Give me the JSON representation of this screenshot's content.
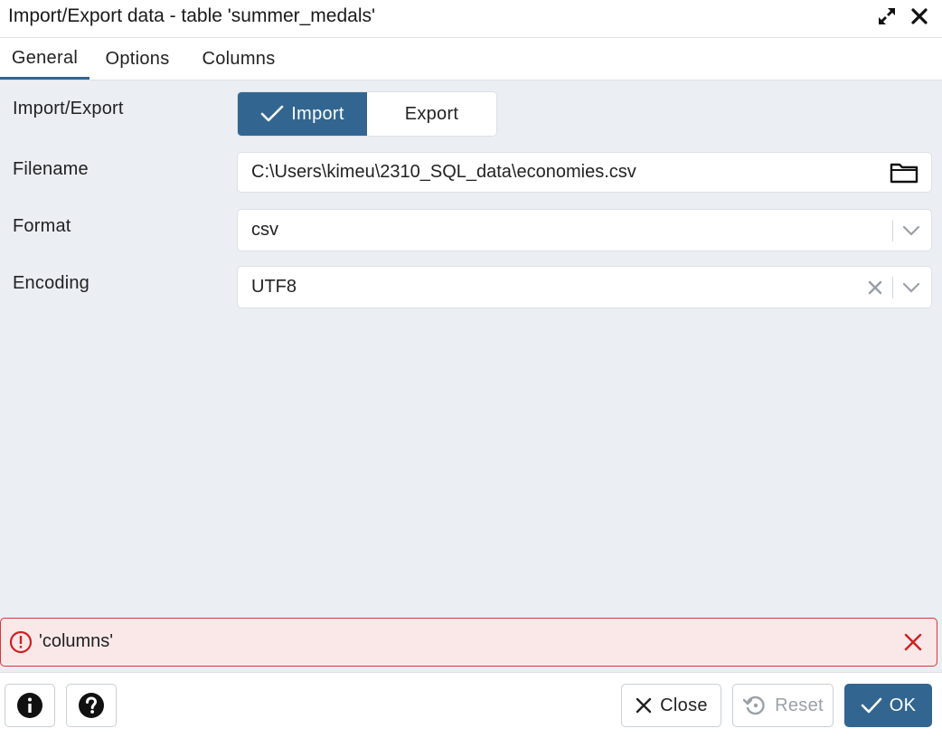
{
  "window": {
    "title": "Import/Export data - table 'summer_medals'",
    "actions": [
      "expand-icon",
      "close-icon"
    ]
  },
  "tabs": [
    {
      "label": "General",
      "active": true
    },
    {
      "label": "Options",
      "active": false
    },
    {
      "label": "Columns",
      "active": false
    }
  ],
  "form": {
    "import_export": {
      "label": "Import/Export",
      "options": [
        "Import",
        "Export"
      ],
      "selected": "Import"
    },
    "filename": {
      "label": "Filename",
      "value": "C:\\Users\\kimeu\\2310_SQL_data\\economies.csv",
      "icon": "folder-icon"
    },
    "format": {
      "label": "Format",
      "value": "csv"
    },
    "encoding": {
      "label": "Encoding",
      "value": "UTF8"
    }
  },
  "error": {
    "message": "'columns'",
    "icon": "error-circle-icon"
  },
  "footer": {
    "info_icon": "info-icon",
    "help_icon": "help-icon",
    "close_label": "Close",
    "reset_label": "Reset",
    "ok_label": "OK"
  },
  "colors": {
    "accent": "#326690",
    "content_bg": "#ebeef3",
    "error_border": "#d23a3a",
    "error_bg": "#fae8e9"
  }
}
